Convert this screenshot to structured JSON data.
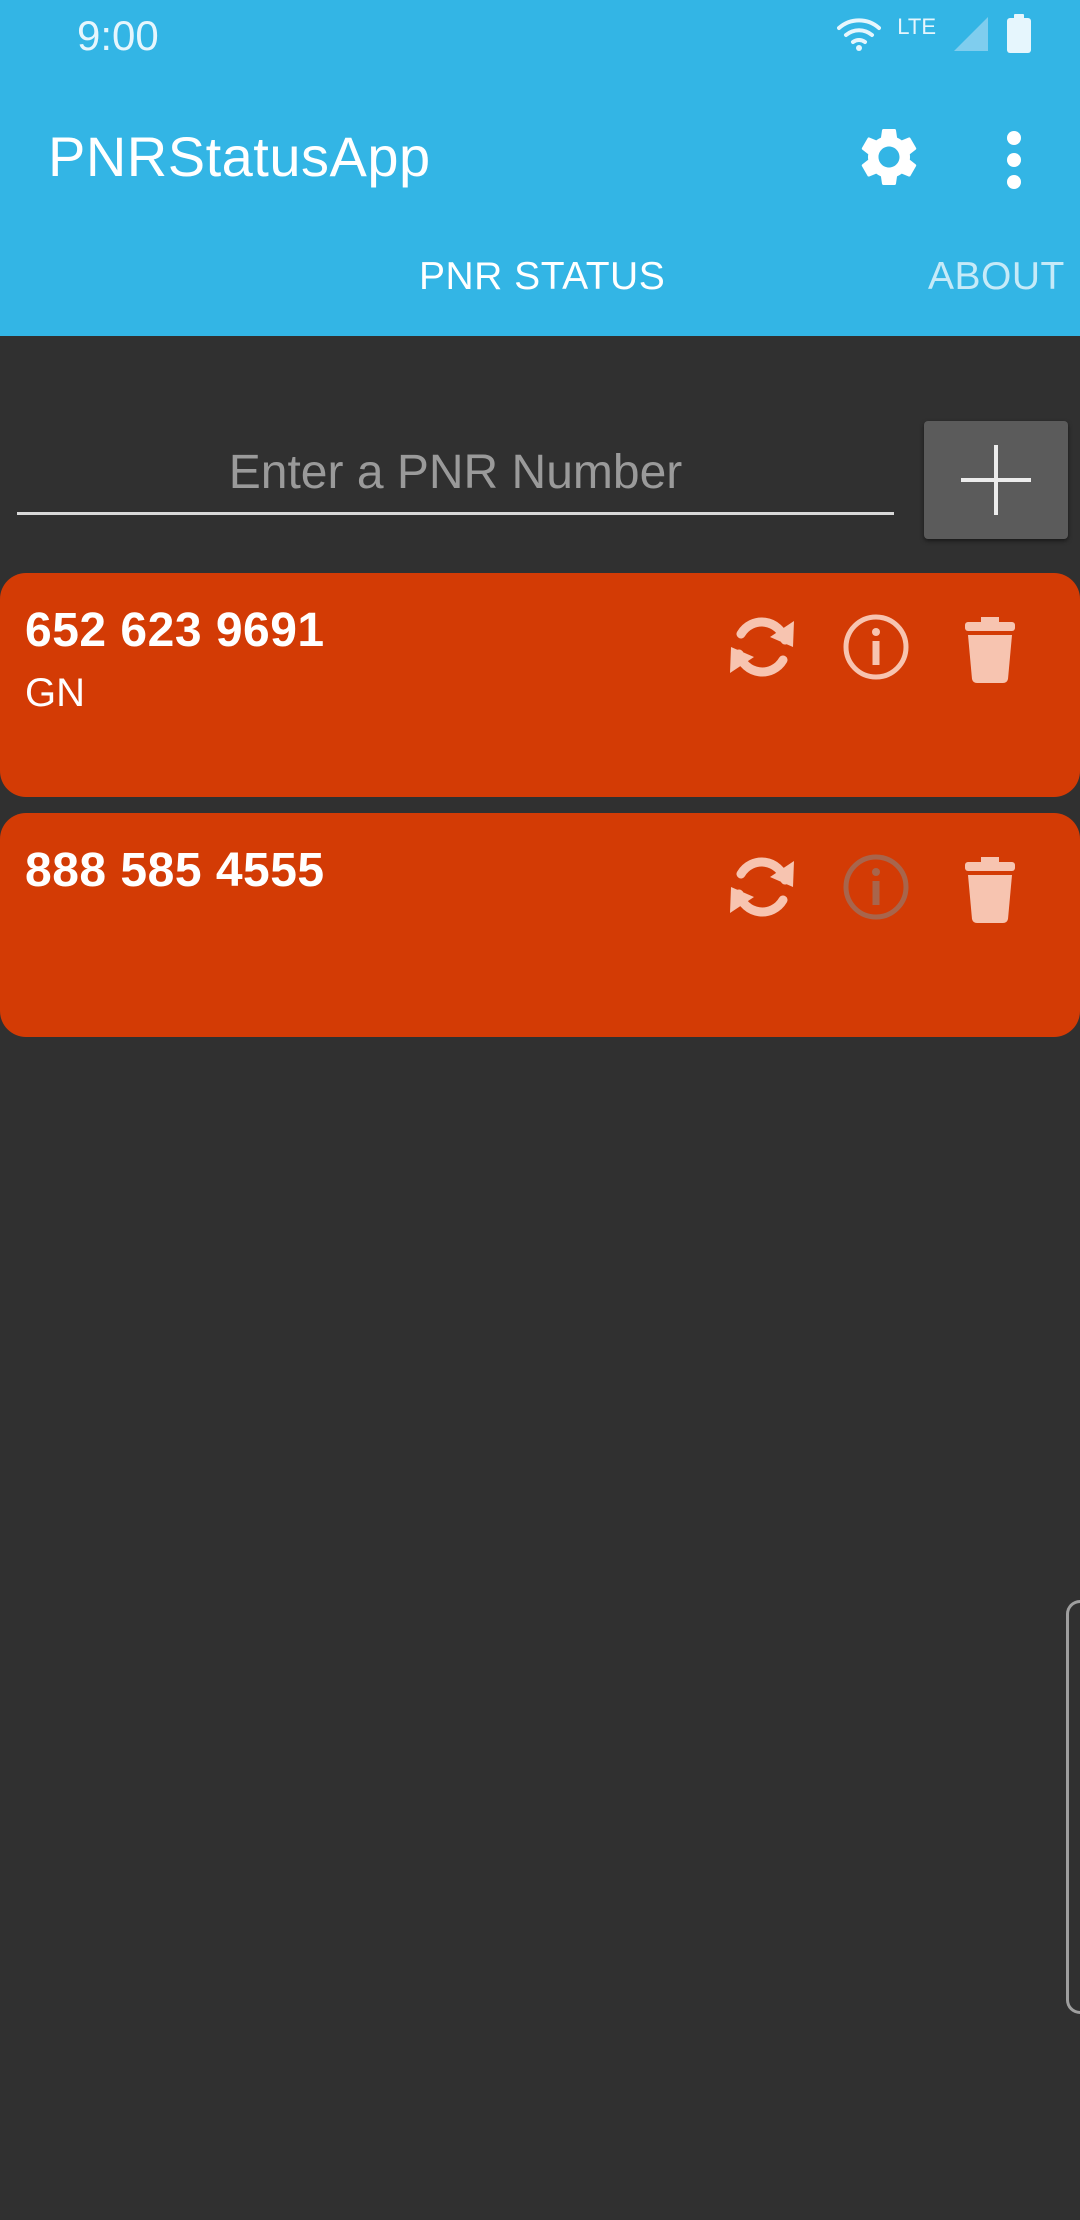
{
  "status_bar": {
    "time": "9:00",
    "network": "LTE"
  },
  "app": {
    "title": "PNRStatusApp"
  },
  "tabs": [
    {
      "label": "PNR STATUS",
      "selected": true
    },
    {
      "label": "ABOUT",
      "selected": false
    }
  ],
  "pnr_input": {
    "value": "",
    "placeholder": "Enter a PNR Number"
  },
  "pnr_list": [
    {
      "number": "652 623 9691",
      "class": "GN",
      "info_enabled": true
    },
    {
      "number": "888 585 4555",
      "class": "",
      "info_enabled": false
    }
  ],
  "icons": {
    "settings": "gear-icon",
    "overflow": "more-vert-icon",
    "add": "plus-icon",
    "refresh": "refresh-icon",
    "info": "info-icon",
    "delete": "trash-icon"
  },
  "colors": {
    "app_bar": "#33b5e5",
    "background": "#303030",
    "card": "#d33b05",
    "add_button": "#5b5b5b",
    "card_icon": "#f7c4b0"
  }
}
